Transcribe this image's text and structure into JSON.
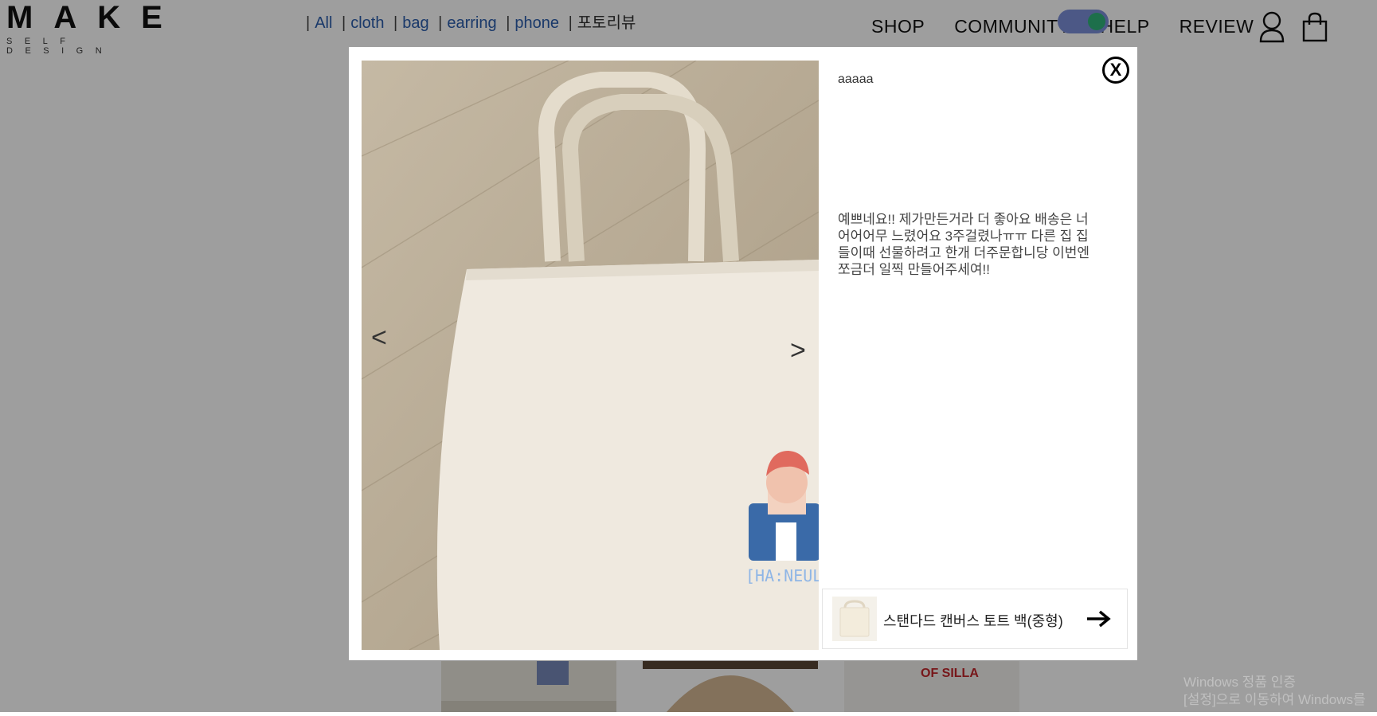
{
  "header": {
    "logo": {
      "main": "MAKE",
      "sub": "SELF DESIGN"
    },
    "filters": [
      {
        "label": "All"
      },
      {
        "label": "cloth"
      },
      {
        "label": "bag"
      },
      {
        "label": "earring"
      },
      {
        "label": "phone"
      },
      {
        "label": "포토리뷰"
      }
    ],
    "nav": [
      {
        "label": "SHOP"
      },
      {
        "label": "COMMUNITY"
      },
      {
        "label": "HELP"
      },
      {
        "label": "REVIEW"
      }
    ],
    "icons": [
      "user-icon",
      "shopping-bag-icon"
    ]
  },
  "modal": {
    "close_label": "X",
    "prev_label": "<",
    "next_label": ">",
    "photo_caption": "[HA:NEUL]",
    "reviewer": "aaaaa",
    "review_text": "예쁘네요!! 제가만든거라 더 좋아요 배송은 너어어어무 느렸어요 3주걸렸나ㅠㅠ 다른 집 집들이때 선물하려고 한개 더주문합니당 이번엔 쪼금더 일찍 만들어주세여!!",
    "product": {
      "name": "스탠다드 캔버스 토트 백(중형)"
    }
  },
  "watermark": {
    "line1": "Windows 정품 인증",
    "line2": "[설정]으로 이동하여 Windows를"
  },
  "colors": {
    "link": "#2a5cab",
    "overlay": "rgba(0,0,0,0.38)",
    "toggle": "#7b8fd8",
    "toggle_knob": "#2fb37a"
  }
}
